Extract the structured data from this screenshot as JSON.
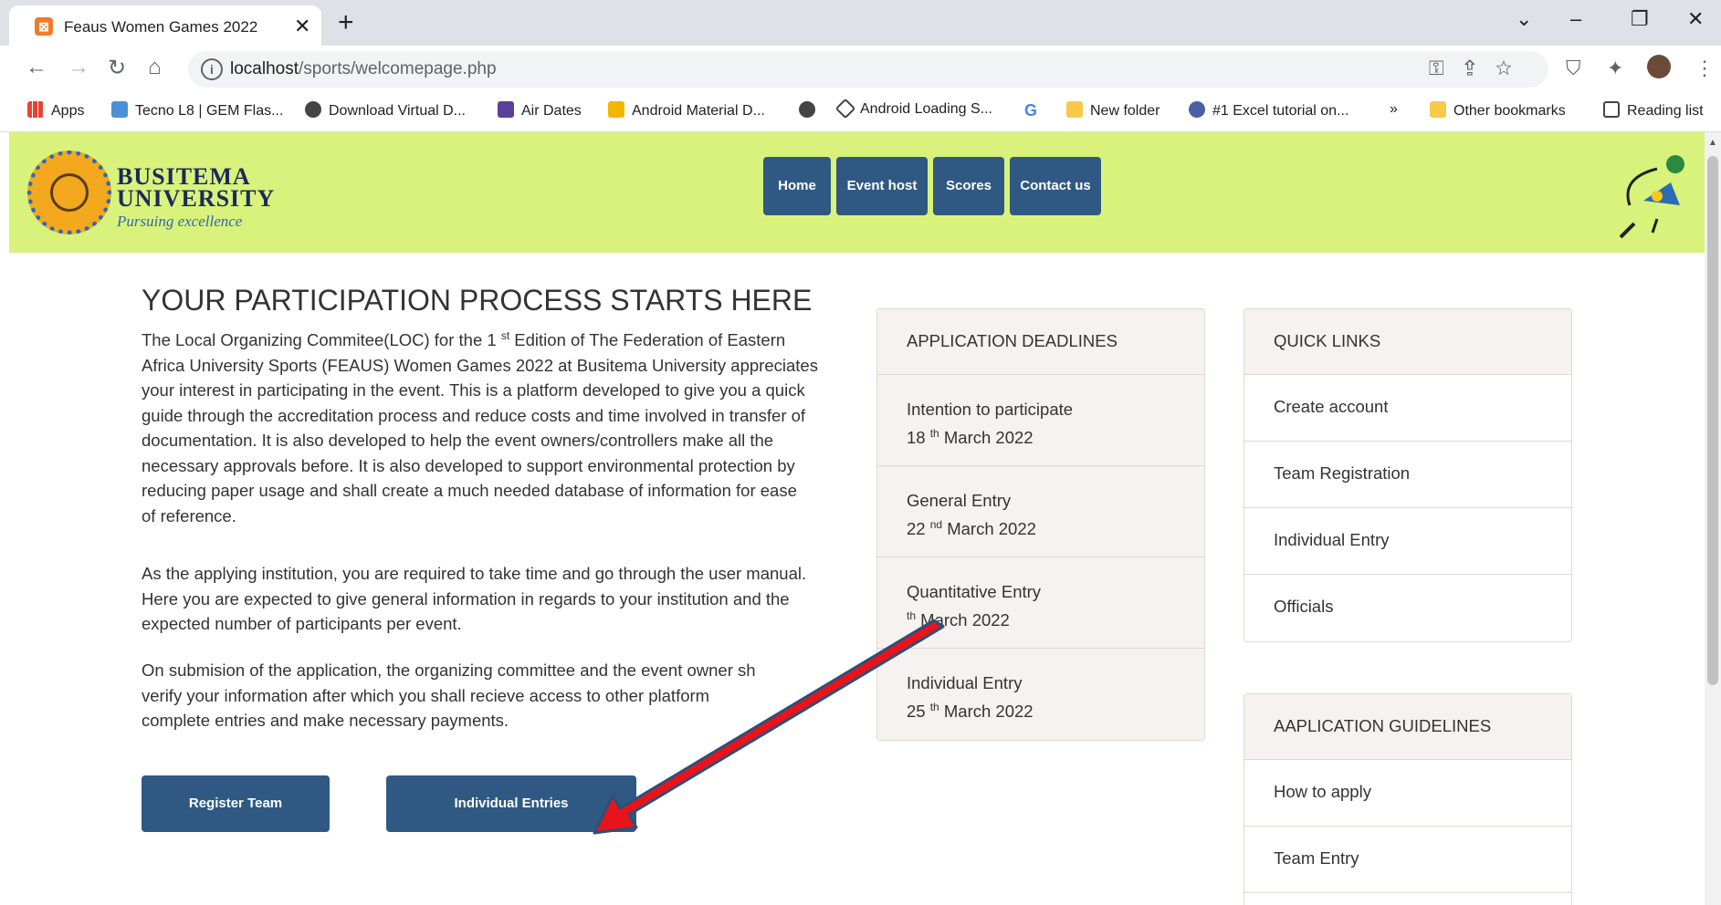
{
  "browser": {
    "tab_title": "Feaus Women Games 2022",
    "tab_close": "✕",
    "new_tab": "+",
    "url_host": "localhost",
    "url_path": "/sports/welcomepage.php",
    "bookmarks": [
      "Apps",
      "Tecno L8 | GEM Flas...",
      "Download Virtual D...",
      "Air Dates",
      "Android Material D...",
      "Android Loading S...",
      "New folder",
      "#1 Excel tutorial on...",
      "»",
      "Other bookmarks",
      "Reading list"
    ]
  },
  "header": {
    "brand_line1": "BUSITEMA",
    "brand_line2": "UNIVERSITY",
    "brand_tagline": "Pursuing excellence",
    "nav": [
      "Home",
      "Event host",
      "Scores",
      "Contact us"
    ]
  },
  "main": {
    "heading": "YOUR PARTICIPATION PROCESS STARTS HERE",
    "p1_lines": [
      "The Local Organizing Commitee(LOC) for the 1 st Edition of The Federation of Eastern",
      "Africa University Sports (FEAUS) Women Games 2022 at Busitema University appreciates",
      "your interest in participating in the event. This is a platform developed to give you a quick",
      "guide through the accreditation process and reduce costs and time involved in transfer of",
      "documentation. It is also developed to help the event owners/controllers make all the",
      "necessary approvals before. It is also developed to support environmental protection by",
      "reducing paper usage and shall create a much needed database of information for ease",
      "of reference."
    ],
    "p2_lines": [
      "As the applying institution, you are required to take time and go through the user manual.",
      "Here you are expected to give general information in regards to your institution and the",
      "expected number of participants per event."
    ],
    "p3_lines": [
      "On submision of the application, the organizing committee and the event owner sh",
      "verify your information after which you shall recieve access to other platform",
      "complete entries and make necessary payments."
    ],
    "register_team": "Register Team",
    "individual_entries": "Individual Entries"
  },
  "deadlines": {
    "title": "APPLICATION DEADLINES",
    "items": [
      {
        "label": "Intention to participate",
        "day": "18",
        "sup": "th",
        "rest": " March 2022"
      },
      {
        "label": "General Entry",
        "day": "22",
        "sup": "nd",
        "rest": " March 2022"
      },
      {
        "label": "Quantitative Entry",
        "day": "",
        "sup": "th",
        "rest": " March 2022"
      },
      {
        "label": "Individual Entry",
        "day": "25",
        "sup": "th",
        "rest": " March 2022"
      }
    ]
  },
  "quick_links": {
    "title": "QUICK LINKS",
    "items": [
      "Create account",
      "Team Registration",
      "Individual Entry",
      "Officials"
    ]
  },
  "guidelines": {
    "title": "AAPLICATION GUIDELINES",
    "items": [
      "How to apply",
      "Team Entry"
    ]
  },
  "colors": {
    "header_bg": "#d9f27c",
    "button_bg": "#2f5983",
    "annotation_arrow": "#e8141b"
  }
}
